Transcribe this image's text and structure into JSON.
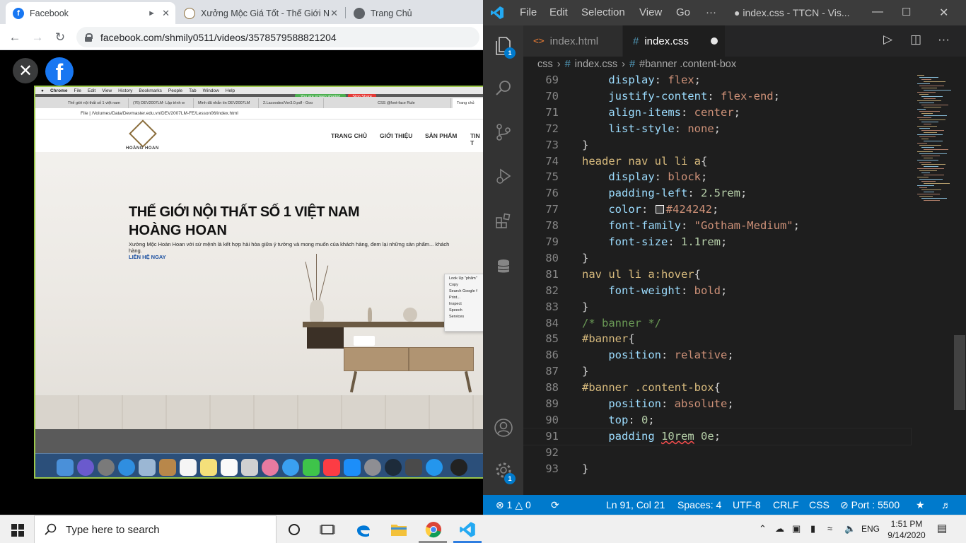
{
  "chrome": {
    "tabs": [
      {
        "title": "Facebook",
        "active": true
      },
      {
        "title": "Xưởng Mộc Giá Tốt - Thế Giới N",
        "active": false
      },
      {
        "title": "Trang Chủ",
        "active": false
      }
    ],
    "url": "facebook.com/shmily0511/videos/3578579588821204",
    "video": {
      "mac_menu": [
        "Chrome",
        "File",
        "Edit",
        "View",
        "History",
        "Bookmarks",
        "People",
        "Tab",
        "Window",
        "Help"
      ],
      "sharing_text": "You are screen sharing",
      "stop_share": "Stop Share",
      "inner_tabs": [
        "Thế giới nội thất số 1 việt nam",
        "(76) DEV2007LM- Lập trình w",
        "Minh đã nhắn tin DEV2007LM",
        "2.Lacoodes/Ver3.0.pdf - Goo",
        "CSS @font-face Rule",
        "Trang chủ"
      ],
      "inner_url": "File  |  /Volumes/Data/Devmaster.edu.vn/DEV2007LM-FE/Lesson06/index.html",
      "site_logo": "HOÀNG HOAN",
      "site_nav": [
        "TRANG CHỦ",
        "GIỚI THIỆU",
        "SẢN PHẨM",
        "TIN T"
      ],
      "hero_title_1": "THẾ GIỚI NỘI THẤT SỐ 1 VIỆT NAM",
      "hero_title_2": "HOÀNG HOAN",
      "hero_desc": "Xưởng Mộc Hoàn Hoan với sứ mệnh là kết hợp hài hòa giữa ý tưởng và mong muốn của khách hàng, đem lại những sản phẩm... khách hàng.",
      "hero_link": "LIÊN HỆ NGAY",
      "context_menu": [
        "Look Up \"phẩm\"",
        "Copy",
        "Search Google f",
        "Print...",
        "Inspect",
        "Speech",
        "Services"
      ]
    }
  },
  "vscode": {
    "menu": [
      "File",
      "Edit",
      "Selection",
      "View",
      "Go",
      "···"
    ],
    "window_title": "● index.css - TTCN - Vis...",
    "tabs": [
      {
        "icon": "<>",
        "label": "index.html"
      },
      {
        "icon": "#",
        "label": "index.css"
      }
    ],
    "breadcrumb": [
      "css",
      "index.css",
      "#banner .content-box"
    ],
    "explorer_badge": "1",
    "settings_badge": "1",
    "status": {
      "problems_errors": "1",
      "problems_warnings": "0",
      "position": "Ln 91, Col 21",
      "spaces": "Spaces: 4",
      "encoding": "UTF-8",
      "eol": "CRLF",
      "language": "CSS",
      "port": "Port : 5500"
    },
    "lines": [
      {
        "n": "69",
        "text": "    display: flex;"
      },
      {
        "n": "70",
        "text": "    justify-content: flex-end;"
      },
      {
        "n": "71",
        "text": "    align-items: center;"
      },
      {
        "n": "72",
        "text": "    list-style: none;"
      },
      {
        "n": "73",
        "text": "}"
      },
      {
        "n": "74",
        "text": "header nav ul li a{"
      },
      {
        "n": "75",
        "text": "    display: block;"
      },
      {
        "n": "76",
        "text": "    padding-left: 2.5rem;"
      },
      {
        "n": "77",
        "text": "    color: #424242;"
      },
      {
        "n": "78",
        "text": "    font-family: \"Gotham-Medium\";"
      },
      {
        "n": "79",
        "text": "    font-size: 1.1rem;"
      },
      {
        "n": "80",
        "text": "}"
      },
      {
        "n": "81",
        "text": "nav ul li a:hover{"
      },
      {
        "n": "82",
        "text": "    font-weight: bold;"
      },
      {
        "n": "83",
        "text": "}"
      },
      {
        "n": "84",
        "text": "/* banner */"
      },
      {
        "n": "85",
        "text": "#banner{"
      },
      {
        "n": "86",
        "text": "    position: relative;"
      },
      {
        "n": "87",
        "text": "}"
      },
      {
        "n": "88",
        "text": "#banner .content-box{"
      },
      {
        "n": "89",
        "text": "    position: absolute;"
      },
      {
        "n": "90",
        "text": "    top: 0;"
      },
      {
        "n": "91",
        "text": "    padding 10rem 0e;"
      },
      {
        "n": "92",
        "text": ""
      },
      {
        "n": "93",
        "text": "}"
      }
    ]
  },
  "taskbar": {
    "search_placeholder": "Type here to search",
    "language": "ENG",
    "time": "1:51 PM",
    "date": "9/14/2020"
  },
  "colors": {
    "vscode_status": "#007acc",
    "facebook_blue": "#1877f2",
    "swatch": "#424242"
  }
}
